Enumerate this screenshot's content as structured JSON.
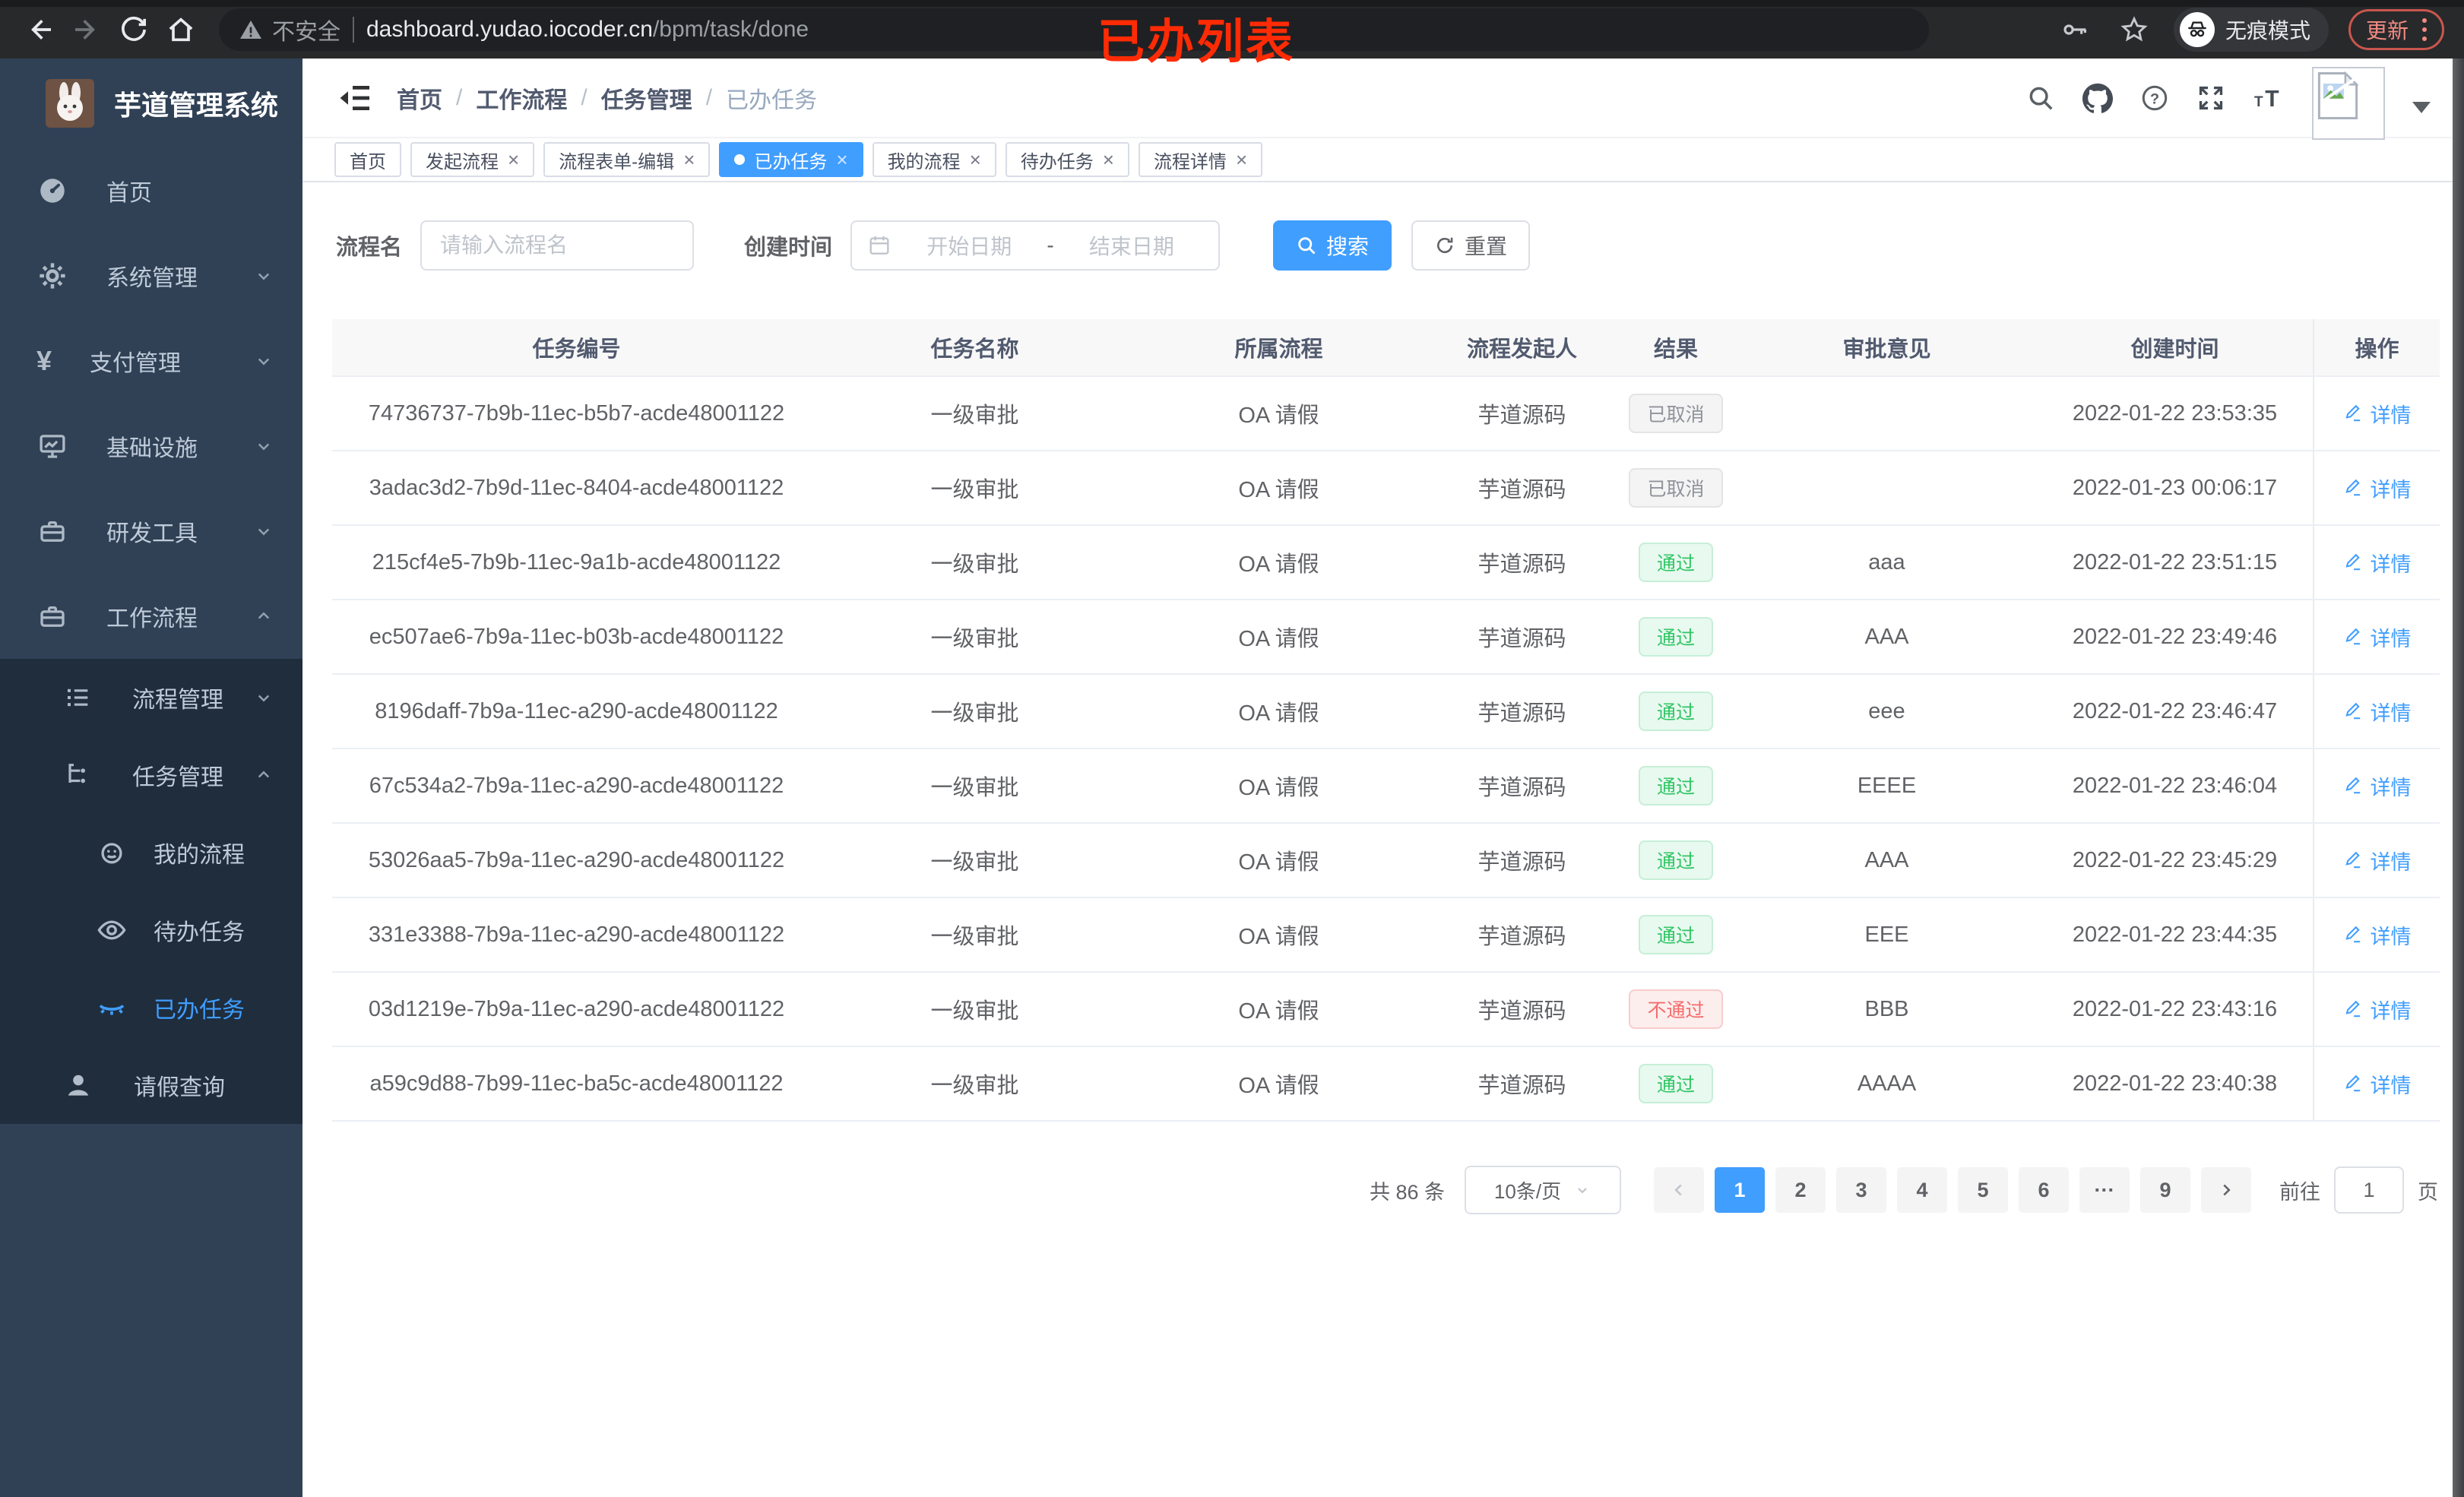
{
  "browser": {
    "security_label": "不安全",
    "url_host": "dashboard.yudao.iocoder.cn",
    "url_path": "/bpm/task/done",
    "incognito_label": "无痕模式",
    "update_label": "更新"
  },
  "annotation": {
    "text": "已办列表",
    "color": "#ff2b05"
  },
  "sidebar": {
    "logo_title": "芋道管理系统",
    "items": [
      {
        "label": "首页",
        "icon": "dashboard-icon",
        "level": 0,
        "active": false
      },
      {
        "label": "系统管理",
        "icon": "gear-icon",
        "level": 0,
        "expanded": false,
        "active": false
      },
      {
        "label": "支付管理",
        "icon": "yen-icon",
        "level": 0,
        "expanded": false,
        "active": false
      },
      {
        "label": "基础设施",
        "icon": "monitor-icon",
        "level": 0,
        "expanded": false,
        "active": false
      },
      {
        "label": "研发工具",
        "icon": "toolbox-icon",
        "level": 0,
        "expanded": false,
        "active": false
      },
      {
        "label": "工作流程",
        "icon": "briefcase-icon",
        "level": 0,
        "expanded": true,
        "active": false
      },
      {
        "label": "流程管理",
        "icon": "list-icon",
        "level": 1,
        "expanded": false,
        "active": false
      },
      {
        "label": "任务管理",
        "icon": "tree-icon",
        "level": 1,
        "expanded": true,
        "active": false
      },
      {
        "label": "我的流程",
        "icon": "robot-icon",
        "level": 2,
        "active": false
      },
      {
        "label": "待办任务",
        "icon": "eye-open-icon",
        "level": 2,
        "active": false
      },
      {
        "label": "已办任务",
        "icon": "eye-closed-icon",
        "level": 2,
        "active": true
      },
      {
        "label": "请假查询",
        "icon": "user-icon",
        "level": 1,
        "active": false
      }
    ]
  },
  "navbar": {
    "breadcrumb": [
      "首页",
      "工作流程",
      "任务管理",
      "已办任务"
    ],
    "separator": "/"
  },
  "tabs": [
    {
      "label": "首页",
      "closable": false,
      "active": false
    },
    {
      "label": "发起流程",
      "closable": true,
      "active": false
    },
    {
      "label": "流程表单-编辑",
      "closable": true,
      "active": false
    },
    {
      "label": "已办任务",
      "closable": true,
      "active": true
    },
    {
      "label": "我的流程",
      "closable": true,
      "active": false
    },
    {
      "label": "待办任务",
      "closable": true,
      "active": false
    },
    {
      "label": "流程详情",
      "closable": true,
      "active": false
    }
  ],
  "filter": {
    "name_label": "流程名",
    "name_placeholder": "请输入流程名",
    "name_value": "",
    "date_label": "创建时间",
    "date_start_placeholder": "开始日期",
    "date_separator": "-",
    "date_end_placeholder": "结束日期",
    "search_label": "搜索",
    "reset_label": "重置"
  },
  "table": {
    "columns": [
      "任务编号",
      "任务名称",
      "所属流程",
      "流程发起人",
      "结果",
      "审批意见",
      "创建时间",
      "操作"
    ],
    "rows": [
      {
        "id": "74736737-7b9b-11ec-b5b7-acde48001122",
        "name": "一级审批",
        "process": "OA 请假",
        "starter": "芋道源码",
        "result": "已取消",
        "result_type": "info",
        "comment": "",
        "created": "2022-01-22 23:53:35"
      },
      {
        "id": "3adac3d2-7b9d-11ec-8404-acde48001122",
        "name": "一级审批",
        "process": "OA 请假",
        "starter": "芋道源码",
        "result": "已取消",
        "result_type": "info",
        "comment": "",
        "created": "2022-01-23 00:06:17"
      },
      {
        "id": "215cf4e5-7b9b-11ec-9a1b-acde48001122",
        "name": "一级审批",
        "process": "OA 请假",
        "starter": "芋道源码",
        "result": "通过",
        "result_type": "success",
        "comment": "aaa",
        "created": "2022-01-22 23:51:15"
      },
      {
        "id": "ec507ae6-7b9a-11ec-b03b-acde48001122",
        "name": "一级审批",
        "process": "OA 请假",
        "starter": "芋道源码",
        "result": "通过",
        "result_type": "success",
        "comment": "AAA",
        "created": "2022-01-22 23:49:46"
      },
      {
        "id": "8196daff-7b9a-11ec-a290-acde48001122",
        "name": "一级审批",
        "process": "OA 请假",
        "starter": "芋道源码",
        "result": "通过",
        "result_type": "success",
        "comment": "eee",
        "created": "2022-01-22 23:46:47"
      },
      {
        "id": "67c534a2-7b9a-11ec-a290-acde48001122",
        "name": "一级审批",
        "process": "OA 请假",
        "starter": "芋道源码",
        "result": "通过",
        "result_type": "success",
        "comment": "EEEE",
        "created": "2022-01-22 23:46:04"
      },
      {
        "id": "53026aa5-7b9a-11ec-a290-acde48001122",
        "name": "一级审批",
        "process": "OA 请假",
        "starter": "芋道源码",
        "result": "通过",
        "result_type": "success",
        "comment": "AAA",
        "created": "2022-01-22 23:45:29"
      },
      {
        "id": "331e3388-7b9a-11ec-a290-acde48001122",
        "name": "一级审批",
        "process": "OA 请假",
        "starter": "芋道源码",
        "result": "通过",
        "result_type": "success",
        "comment": "EEE",
        "created": "2022-01-22 23:44:35"
      },
      {
        "id": "03d1219e-7b9a-11ec-a290-acde48001122",
        "name": "一级审批",
        "process": "OA 请假",
        "starter": "芋道源码",
        "result": "不通过",
        "result_type": "danger",
        "comment": "BBB",
        "created": "2022-01-22 23:43:16"
      },
      {
        "id": "a59c9d88-7b99-11ec-ba5c-acde48001122",
        "name": "一级审批",
        "process": "OA 请假",
        "starter": "芋道源码",
        "result": "通过",
        "result_type": "success",
        "comment": "AAAA",
        "created": "2022-01-22 23:40:38"
      }
    ]
  },
  "actions": {
    "detail_label": "详情"
  },
  "pagination": {
    "total_label": "共 86 条",
    "page_size_label": "10条/页",
    "pages": [
      {
        "label": "1",
        "active": true
      },
      {
        "label": "2"
      },
      {
        "label": "3"
      },
      {
        "label": "4"
      },
      {
        "label": "5"
      },
      {
        "label": "6"
      },
      {
        "label": "···",
        "ellipsis": true
      },
      {
        "label": "9"
      }
    ],
    "goto_label": "前往",
    "goto_value": "1",
    "page_unit": "页"
  },
  "colors": {
    "accent": "#409eff",
    "success": "#31c565",
    "success_bg": "#e8f9ef",
    "danger": "#f56c6c",
    "danger_bg": "#fdeeee",
    "info": "#909399",
    "info_bg": "#f4f4f5",
    "sidebar_bg": "#304156",
    "submenu_bg": "#1f2d3d",
    "table_header_bg": "#f8f8f9"
  }
}
